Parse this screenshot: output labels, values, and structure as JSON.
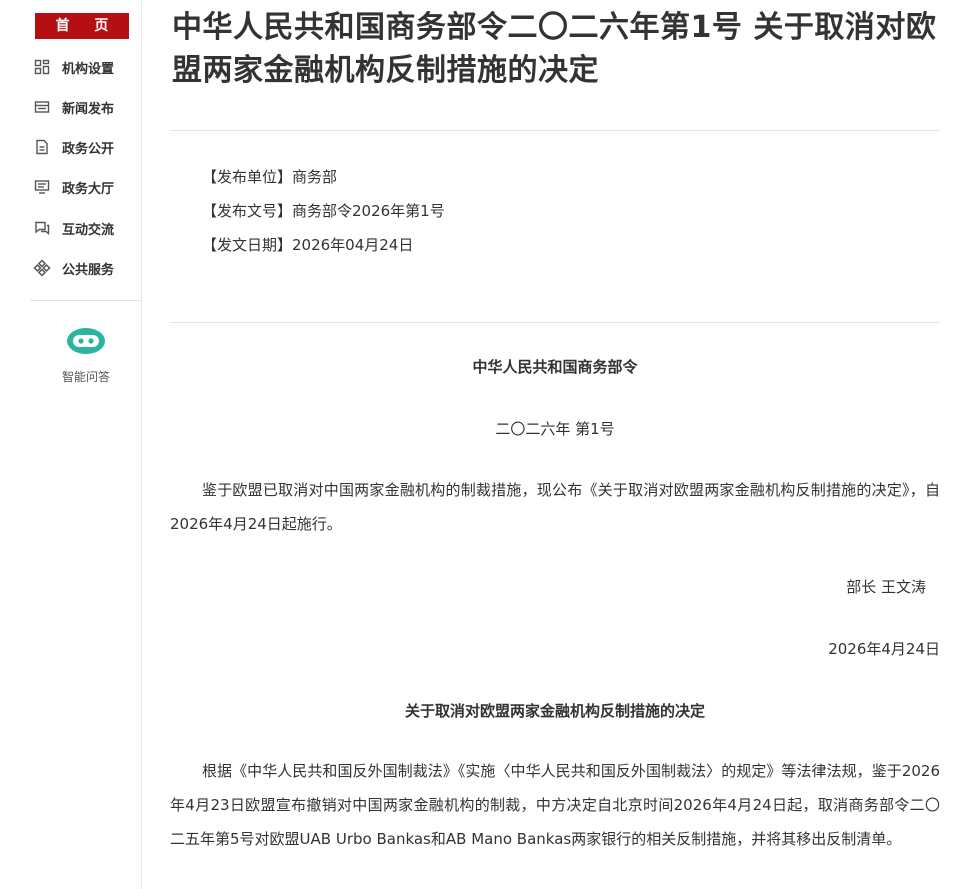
{
  "sidebar": {
    "home_label": "首 页",
    "items": [
      {
        "label": "机构设置",
        "icon": "grid-icon"
      },
      {
        "label": "新闻发布",
        "icon": "news-icon"
      },
      {
        "label": "政务公开",
        "icon": "document-icon"
      },
      {
        "label": "政务大厅",
        "icon": "monitor-icon"
      },
      {
        "label": "互动交流",
        "icon": "chat-icon"
      },
      {
        "label": "公共服务",
        "icon": "service-icon"
      }
    ],
    "ai_label": "智能问答",
    "ai_color": "#2bb5a0",
    "accent_color": "#b40f12"
  },
  "article": {
    "title": "中华人民共和国商务部令二〇二六年第1号 关于取消对欧盟两家金融机构反制措施的决定",
    "meta": {
      "issuer": "【发布单位】商务部",
      "doc_no": "【发布文号】商务部令2026年第1号",
      "date": "【发文日期】2026年04月24日"
    },
    "order_title": "中华人民共和国商务部令",
    "order_no": "二〇二六年 第1号",
    "intro_para": "鉴于欧盟已取消对中国两家金融机构的制裁措施，现公布《关于取消对欧盟两家金融机构反制措施的决定》，自2026年4月24日起施行。",
    "signer": "部长 王文涛",
    "sign_date": "2026年4月24日",
    "decision_title": "关于取消对欧盟两家金融机构反制措施的决定",
    "decision_para": "根据《中华人民共和国反外国制裁法》《实施〈中华人民共和国反外国制裁法〉的规定》等法律法规，鉴于2026年4月23日欧盟宣布撤销对中国两家金融机构的制裁，中方决定自北京时间2026年4月24日起，取消商务部令二〇二五年第5号对欧盟UAB Urbo Bankas和AB Mano Bankas两家银行的相关反制措施，并将其移出反制清单。"
  }
}
